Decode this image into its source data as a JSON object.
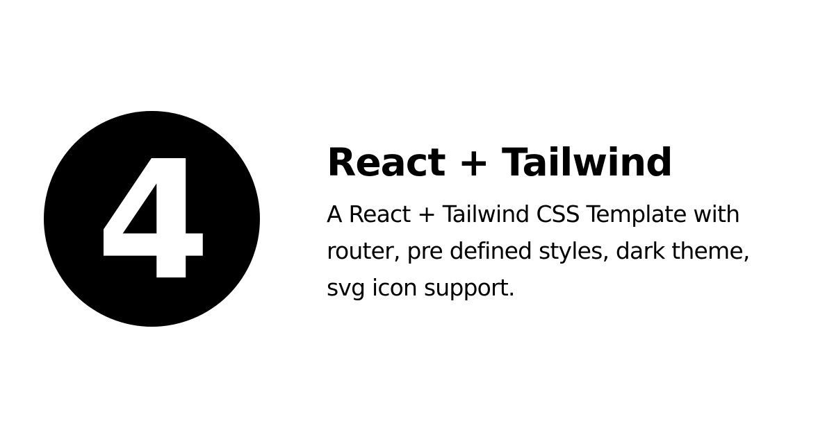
{
  "logo": {
    "mark": "4",
    "background_color": "#000000",
    "mark_color": "#ffffff"
  },
  "title": "React + Tailwind",
  "description": "A React + Tailwind CSS Template with router, pre defined styles, dark theme, svg icon support."
}
